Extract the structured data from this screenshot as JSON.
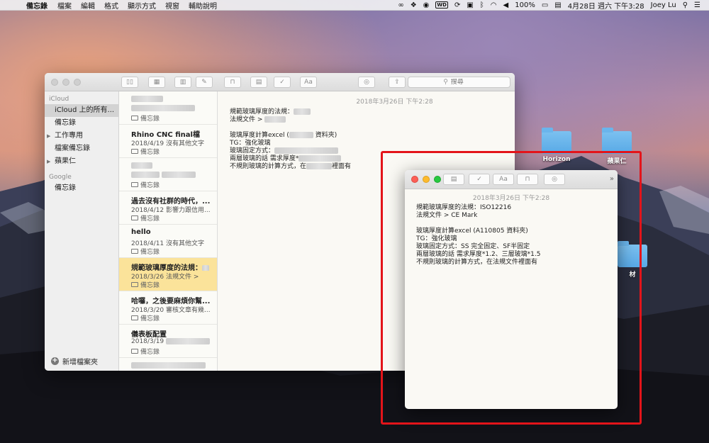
{
  "menubar": {
    "app_name": "備忘錄",
    "menus": [
      "檔案",
      "編輯",
      "格式",
      "顯示方式",
      "視窗",
      "輔助說明"
    ],
    "wd_badge": "WD",
    "battery": "100%",
    "datetime": "4月28日 週六 下午3:28",
    "user": "Joey Lu"
  },
  "toolbar": {
    "search_placeholder": "搜尋"
  },
  "sidebar": {
    "groups": [
      {
        "label": "iCloud",
        "items": [
          {
            "label": "iCloud 上的所有..."
          },
          {
            "label": "備忘錄"
          },
          {
            "label": "工作專用"
          },
          {
            "label": "檔案備忘錄"
          },
          {
            "label": "蘋果仁"
          }
        ]
      },
      {
        "label": "Google",
        "items": [
          {
            "label": "備忘錄"
          }
        ]
      }
    ],
    "new_folder": "新增檔案夾"
  },
  "notes": [
    {
      "title": "",
      "date": "",
      "snippet": "",
      "folder": "備忘錄"
    },
    {
      "title": "Rhino CNC final檔",
      "date": "2018/4/19",
      "snippet": "沒有其他文字",
      "folder": "備忘錄"
    },
    {
      "title": "",
      "date": "",
      "snippet": "",
      "folder": "備忘錄"
    },
    {
      "title": "過去沒有社群的時代，...",
      "date": "2018/4/12",
      "snippet": "影響力跟信用...",
      "folder": "備忘錄"
    },
    {
      "title": "hello",
      "date": "2018/4/11",
      "snippet": "沒有其他文字",
      "folder": "備忘錄"
    },
    {
      "title": "規範玻璃厚度的法規：",
      "date": "2018/3/26",
      "snippet": "法規文件 >",
      "folder": "備忘錄"
    },
    {
      "title": "哈囉，之後要麻煩你幫...",
      "date": "2018/3/20",
      "snippet": "審核文章有幾...",
      "folder": "備忘錄"
    },
    {
      "title": "儀表板配置",
      "date": "2018/3/19",
      "snippet": "",
      "folder": "備忘錄"
    }
  ],
  "editor": {
    "date": "2018年3月26日 下午2:28",
    "lines": [
      "規範玻璃厚度的法規：",
      "法規文件 >",
      "",
      "玻璃厚度計算excel (",
      "TG：強化玻璃",
      "玻璃固定方式：",
      "兩層玻璃的話 需求厚度*",
      "不規則玻璃的計算方式，在"
    ],
    "folder_suffix": "資料夾)",
    "tail": "裡面有"
  },
  "float_note": {
    "date": "2018年3月26日 下午2:28",
    "lines": [
      "規範玻璃厚度的法規：ISO12216",
      "法規文件 > CE Mark",
      "",
      "玻璃厚度計算excel (A110805 資料夾)",
      "TG：強化玻璃",
      "玻璃固定方式：SS 完全固定、SF半固定",
      "兩層玻璃的話 需求厚度*1.2、三層玻璃*1.5",
      "不規則玻璃的計算方式，在法規文件裡面有"
    ]
  },
  "desktop": {
    "icons": [
      {
        "label": "Horizon"
      },
      {
        "label": "蘋果仁"
      },
      {
        "label": "材"
      }
    ]
  }
}
